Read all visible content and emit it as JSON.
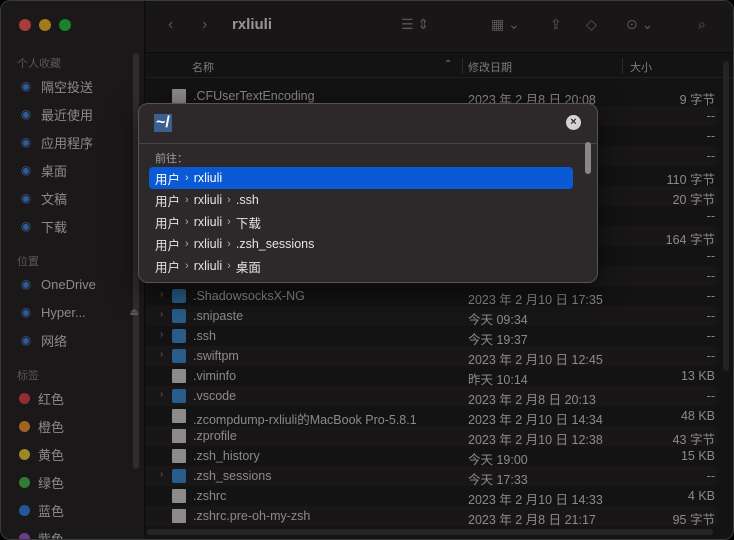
{
  "window": {
    "title": "rxliuli"
  },
  "sidebar": {
    "sections": [
      {
        "title": "个人收藏",
        "items": [
          {
            "label": "隔空投送",
            "icon": "airdrop-icon"
          },
          {
            "label": "最近使用",
            "icon": "clock-icon"
          },
          {
            "label": "应用程序",
            "icon": "apps-icon"
          },
          {
            "label": "桌面",
            "icon": "desktop-icon"
          },
          {
            "label": "文稿",
            "icon": "document-icon"
          },
          {
            "label": "下载",
            "icon": "download-icon"
          }
        ]
      },
      {
        "title": "位置",
        "items": [
          {
            "label": "OneDrive",
            "icon": "cloud-icon"
          },
          {
            "label": "Hyper...",
            "icon": "disk-icon"
          },
          {
            "label": "网络",
            "icon": "network-icon"
          }
        ]
      },
      {
        "title": "标签",
        "items": [
          {
            "label": "红色",
            "color": "#e2484a"
          },
          {
            "label": "橙色",
            "color": "#f39a32"
          },
          {
            "label": "黄色",
            "color": "#f3cf3b"
          },
          {
            "label": "绿色",
            "color": "#4cbd55"
          },
          {
            "label": "蓝色",
            "color": "#3a86e8"
          },
          {
            "label": "紫色",
            "color": "#a55fd0"
          }
        ]
      }
    ]
  },
  "columns": {
    "name": "名称",
    "date": "修改日期",
    "size": "大小"
  },
  "files": [
    {
      "name": ".CFUserTextEncoding",
      "date": "2023 年 2 月8 日 20:08",
      "size": "9 字节",
      "type": "file",
      "expandable": false
    },
    {
      "name": "",
      "date": "",
      "size": "--",
      "type": "hidden",
      "expandable": false
    },
    {
      "name": "",
      "date": "",
      "size": "--",
      "type": "hidden",
      "expandable": false
    },
    {
      "name": "",
      "date": "",
      "size": "--",
      "type": "hidden",
      "expandable": false
    },
    {
      "name": "",
      "date": "",
      "size": "110 字节",
      "type": "hidden",
      "expandable": false
    },
    {
      "name": "",
      "date": "",
      "size": "20 字节",
      "type": "hidden",
      "expandable": false
    },
    {
      "name": "",
      "date": "",
      "size": "--",
      "type": "hidden",
      "expandable": false
    },
    {
      "name": "",
      "date": "",
      "size": "164 字节",
      "type": "hidden",
      "expandable": false
    },
    {
      "name": "",
      "date": "",
      "size": "--",
      "type": "hidden",
      "expandable": false
    },
    {
      "name": "",
      "date": "",
      "size": "--",
      "type": "hidden",
      "expandable": false
    },
    {
      "name": ".ShadowsocksX-NG",
      "date": "2023 年 2 月10 日 17:35",
      "size": "--",
      "type": "folder",
      "expandable": true
    },
    {
      "name": ".snipaste",
      "date": "今天 09:34",
      "size": "--",
      "type": "folder",
      "expandable": true
    },
    {
      "name": ".ssh",
      "date": "今天 19:37",
      "size": "--",
      "type": "folder",
      "expandable": true
    },
    {
      "name": ".swiftpm",
      "date": "2023 年 2 月10 日 12:45",
      "size": "--",
      "type": "folder",
      "expandable": true
    },
    {
      "name": ".viminfo",
      "date": "昨天 10:14",
      "size": "13 KB",
      "type": "file",
      "expandable": false
    },
    {
      "name": ".vscode",
      "date": "2023 年 2 月8 日 20:13",
      "size": "--",
      "type": "folder",
      "expandable": true
    },
    {
      "name": ".zcompdump-rxliuli的MacBook Pro-5.8.1",
      "date": "2023 年 2 月10 日 14:34",
      "size": "48 KB",
      "type": "file",
      "expandable": false
    },
    {
      "name": ".zprofile",
      "date": "2023 年 2 月10 日 12:38",
      "size": "43 字节",
      "type": "file",
      "expandable": false
    },
    {
      "name": ".zsh_history",
      "date": "今天 19:00",
      "size": "15 KB",
      "type": "file",
      "expandable": false
    },
    {
      "name": ".zsh_sessions",
      "date": "今天 17:33",
      "size": "--",
      "type": "folder",
      "expandable": true
    },
    {
      "name": ".zshrc",
      "date": "2023 年 2 月10 日 14:33",
      "size": "4 KB",
      "type": "file",
      "expandable": false
    },
    {
      "name": ".zshrc.pre-oh-my-zsh",
      "date": "2023 年 2 月8 日 21:17",
      "size": "95 字节",
      "type": "file",
      "expandable": false
    }
  ],
  "dialog": {
    "input_value": "~/",
    "goto_label": "前往：",
    "suggestions": [
      {
        "parts": [
          "用户",
          "rxliuli"
        ],
        "selected": true
      },
      {
        "parts": [
          "用户",
          "rxliuli",
          ".ssh"
        ],
        "selected": false
      },
      {
        "parts": [
          "用户",
          "rxliuli",
          "下载"
        ],
        "selected": false
      },
      {
        "parts": [
          "用户",
          "rxliuli",
          ".zsh_sessions"
        ],
        "selected": false
      },
      {
        "parts": [
          "用户",
          "rxliuli",
          "桌面"
        ],
        "selected": false
      }
    ]
  }
}
